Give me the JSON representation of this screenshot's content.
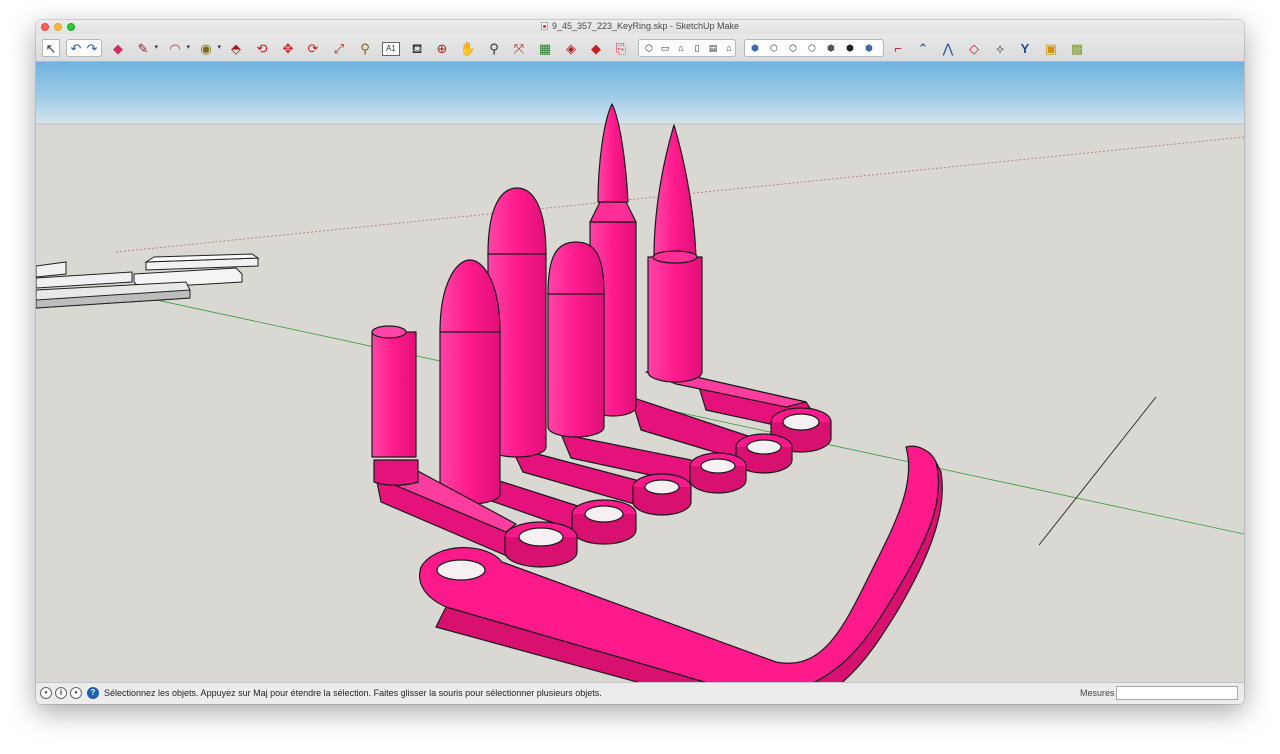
{
  "window": {
    "title": "9_45_357_223_KeyRing.skp - SketchUp Make"
  },
  "toolbar": {
    "tools": [
      {
        "name": "select-tool",
        "glyph": "↖"
      },
      {
        "name": "undo-button",
        "glyph": "↶"
      },
      {
        "name": "redo-button",
        "glyph": "↷"
      },
      {
        "name": "eraser-tool",
        "glyph": "⌫"
      },
      {
        "name": "pencil-tool",
        "glyph": "✎"
      },
      {
        "name": "arc-tool",
        "glyph": "◠"
      },
      {
        "name": "shapes-tool",
        "glyph": "◉"
      },
      {
        "name": "push-pull-tool",
        "glyph": "⬘"
      },
      {
        "name": "offset-tool",
        "glyph": "↻"
      },
      {
        "name": "move-tool",
        "glyph": "✥"
      },
      {
        "name": "rotate-tool",
        "glyph": "⟳"
      },
      {
        "name": "scale-tool",
        "glyph": "⤡"
      },
      {
        "name": "tape-measure-tool",
        "glyph": "📏"
      },
      {
        "name": "text-tool",
        "glyph": "A1"
      },
      {
        "name": "paint-bucket-tool",
        "glyph": "🪣"
      },
      {
        "name": "orbit-tool",
        "glyph": "⊕"
      },
      {
        "name": "pan-tool",
        "glyph": "✋"
      },
      {
        "name": "zoom-tool",
        "glyph": "🔍"
      },
      {
        "name": "zoom-extents-tool",
        "glyph": "⤢"
      },
      {
        "name": "warehouse-button",
        "glyph": "▦"
      },
      {
        "name": "extension-warehouse-button",
        "glyph": "◈"
      },
      {
        "name": "share-model-button",
        "glyph": "◆"
      },
      {
        "name": "layout-button",
        "glyph": "⎘"
      }
    ],
    "views": [
      "iso-view",
      "top-view",
      "front-view",
      "right-view",
      "back-view",
      "left-view"
    ],
    "styles": [
      "xray-style",
      "back-edges-style",
      "wireframe-style",
      "hidden-line-style",
      "shaded-style",
      "shaded-textures-style",
      "monochrome-style"
    ],
    "sandbox": [
      {
        "name": "sandbox-contours-tool",
        "glyph": "⌐"
      },
      {
        "name": "sandbox-scratch-tool",
        "glyph": "⌃"
      },
      {
        "name": "smoove-tool",
        "glyph": "⋀"
      },
      {
        "name": "stamp-tool",
        "glyph": "◇"
      },
      {
        "name": "drape-tool",
        "glyph": "⟡"
      },
      {
        "name": "add-detail-tool",
        "glyph": "Y"
      },
      {
        "name": "flip-edge-tool",
        "glyph": "▣"
      },
      {
        "name": "solid-tools-button",
        "glyph": "▩"
      }
    ]
  },
  "status": {
    "message": "Sélectionnez les objets. Appuyez sur Maj pour étendre la sélection. Faites glisser la souris pour sélectionner plusieurs objets.",
    "measurements_label": "Mesures",
    "measurements_value": ""
  },
  "colors": {
    "model": "#ff1a8c",
    "model_dark": "#e0147a",
    "model_light": "#ff4aa6",
    "ground": "#d9d8d3",
    "sky_top": "#6fb3df"
  }
}
